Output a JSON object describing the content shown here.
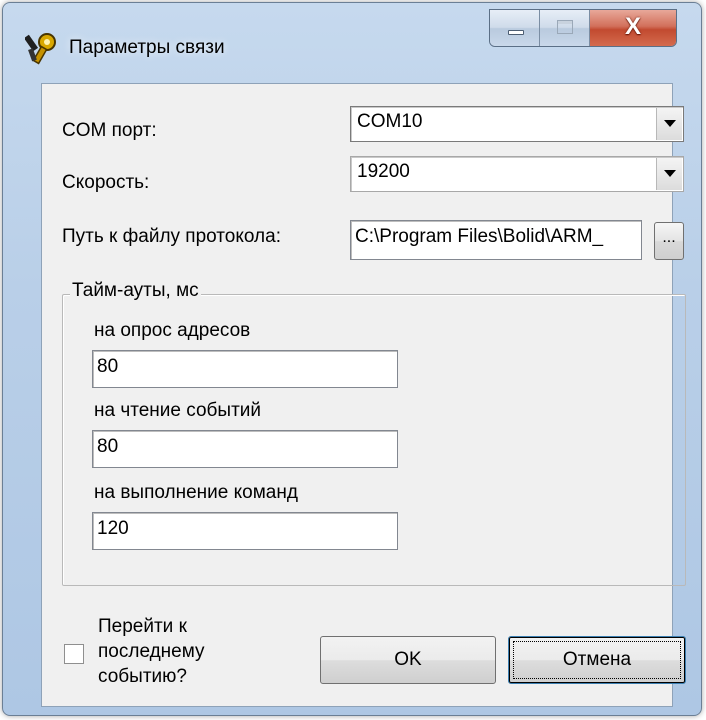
{
  "window": {
    "title": "Параметры связи",
    "icon": "bolid-keys-icon",
    "caption_buttons": {
      "close_glyph": "X"
    }
  },
  "form": {
    "com_port": {
      "label": "COM порт:",
      "value": "COM10"
    },
    "speed": {
      "label": "Скорость:",
      "value": "19200"
    },
    "log_path": {
      "label": "Путь к файлу протокола:",
      "value": "C:\\Program Files\\Bolid\\ARM_",
      "browse_label": "..."
    }
  },
  "timeouts": {
    "title": "Тайм-ауты, мс",
    "poll": {
      "label": "на опрос адресов",
      "value": "80"
    },
    "read": {
      "label": "на чтение событий",
      "value": "80"
    },
    "exec": {
      "label": "на выполнение команд",
      "value": "120"
    }
  },
  "footer": {
    "goto_last": {
      "checked": false,
      "line1": "Перейти к",
      "line2": "последнему",
      "line3": "событию?"
    },
    "ok_label": "OK",
    "cancel_label": "Отмена"
  },
  "colors": {
    "title_bar": "#b9cfe8",
    "close_button": "#c24a30",
    "dialog_face": "#f0f0f0"
  }
}
